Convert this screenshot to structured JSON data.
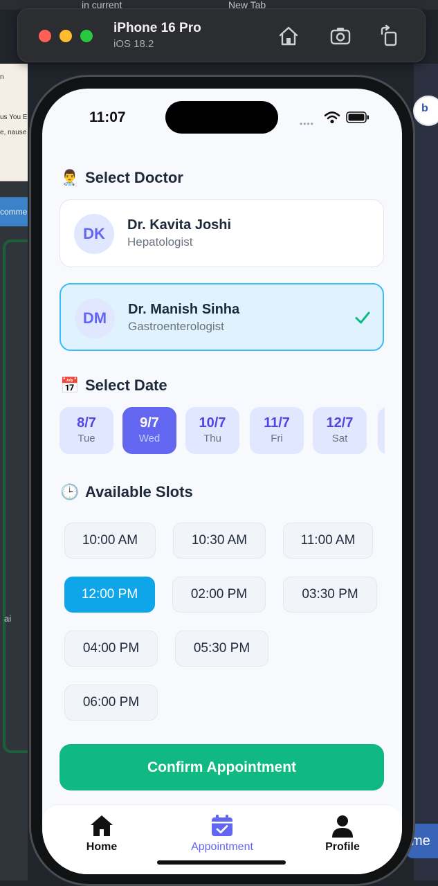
{
  "desktop": {
    "tabs": [
      "in current",
      "New Tab"
    ],
    "left_doc_lines": [
      "n",
      "us You Er",
      "e, nause"
    ],
    "left_blue_text": "comme",
    "left_side_text": "ai",
    "right_badge_text": "b",
    "right_bottom_text": "me"
  },
  "simulator": {
    "device_name": "iPhone 16 Pro",
    "os_version": "iOS 18.2",
    "buttons": [
      "home-icon",
      "screenshot-icon",
      "rotate-icon"
    ]
  },
  "status_bar": {
    "time": "11:07"
  },
  "doctor_section": {
    "emoji": "👨‍⚕️",
    "title": "Select Doctor",
    "doctors": [
      {
        "initials": "DK",
        "name": "Dr. Kavita Joshi",
        "specialty": "Hepatologist",
        "selected": false
      },
      {
        "initials": "DM",
        "name": "Dr. Manish Sinha",
        "specialty": "Gastroenterologist",
        "selected": true
      }
    ]
  },
  "date_section": {
    "emoji": "📅",
    "title": "Select Date",
    "dates": [
      {
        "date": "8/7",
        "day": "Tue",
        "selected": false
      },
      {
        "date": "9/7",
        "day": "Wed",
        "selected": true
      },
      {
        "date": "10/7",
        "day": "Thu",
        "selected": false
      },
      {
        "date": "11/7",
        "day": "Fri",
        "selected": false
      },
      {
        "date": "12/7",
        "day": "Sat",
        "selected": false
      }
    ]
  },
  "slots_section": {
    "emoji": "🕒",
    "title": "Available Slots",
    "slots": [
      {
        "time": "10:00 AM",
        "selected": false
      },
      {
        "time": "10:30 AM",
        "selected": false
      },
      {
        "time": "11:00 AM",
        "selected": false
      },
      {
        "time": "12:00 PM",
        "selected": true
      },
      {
        "time": "02:00 PM",
        "selected": false
      },
      {
        "time": "03:30 PM",
        "selected": false
      },
      {
        "time": "04:00 PM",
        "selected": false
      },
      {
        "time": "05:30 PM",
        "selected": false
      },
      {
        "time": "06:00 PM",
        "selected": false
      }
    ]
  },
  "confirm_button": "Confirm Appointment",
  "tab_bar": {
    "tabs": [
      {
        "label": "Home",
        "icon": "home-icon",
        "active": false
      },
      {
        "label": "Appointment",
        "icon": "calendar-icon",
        "active": true
      },
      {
        "label": "Profile",
        "icon": "profile-icon",
        "active": false
      }
    ]
  },
  "colors": {
    "accent": "#6366f1",
    "selected_slot": "#0ea5e9",
    "confirm": "#10b981",
    "check": "#10b981"
  }
}
